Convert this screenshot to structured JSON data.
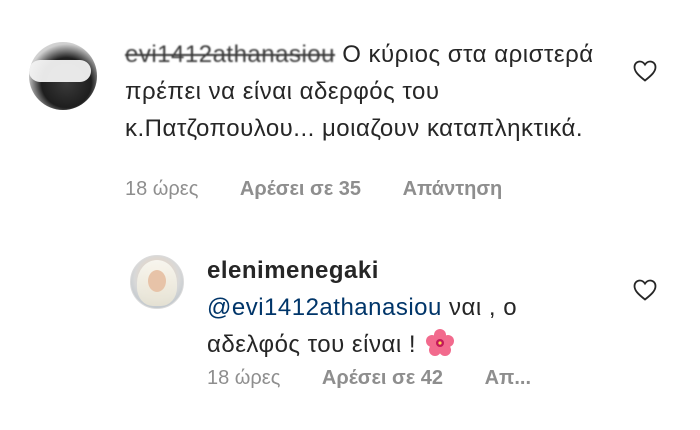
{
  "comments": [
    {
      "username": "evi1412athanasiou",
      "text": "Ο κύριος στα αριστερά πρέπει να είναι αδερφός του κ.Πατζοπουλου... μοιαζουν καταπληκτικά.",
      "time": "18 ώρες",
      "likes": "Αρέσει σε 35",
      "reply": "Απάντηση",
      "icons": {
        "avatar": "avatar-blurred",
        "like": "heart-outline-icon"
      }
    },
    {
      "username": "elenimenegaki",
      "mention": "@evi1412athanasiou",
      "text": "ναι , ο αδελφός του είναι !",
      "emoji": "hibiscus-emoji",
      "time": "18 ώρες",
      "likes": "Αρέσει σε 42",
      "reply": "Απ...",
      "icons": {
        "avatar": "avatar-woman",
        "like": "heart-outline-icon"
      }
    }
  ],
  "colors": {
    "text": "#262626",
    "meta": "#8e8e8e",
    "mention": "#003569",
    "heart": "#262626"
  }
}
